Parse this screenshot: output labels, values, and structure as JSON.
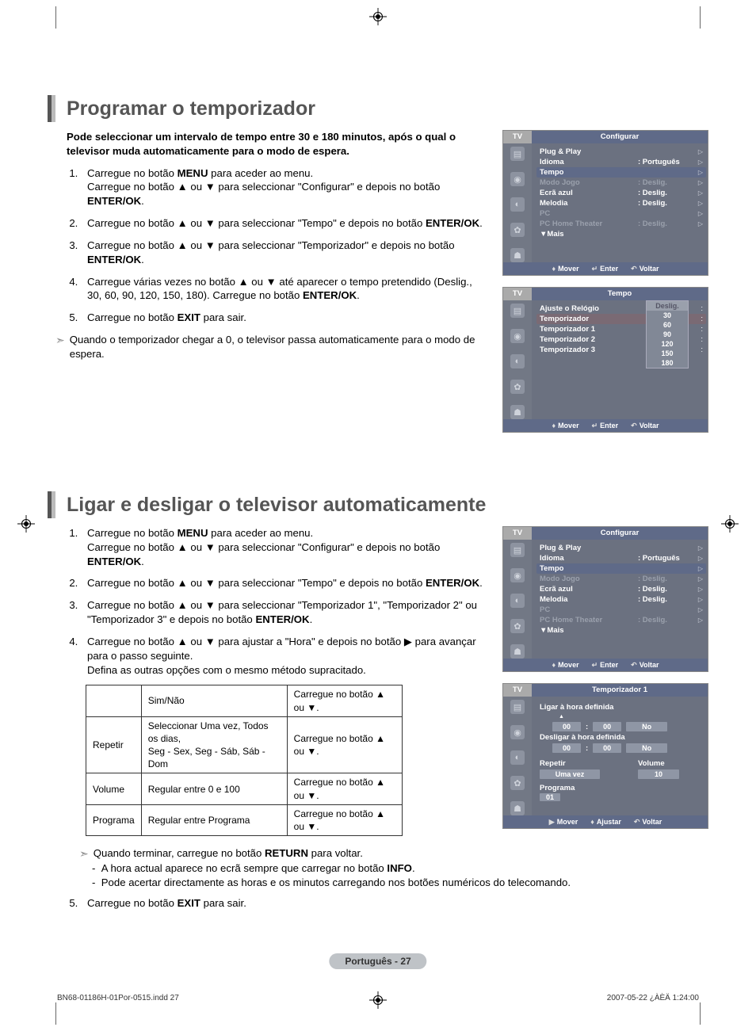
{
  "section1": {
    "title": "Programar o temporizador",
    "intro": "Pode seleccionar um intervalo de tempo entre 30 e 180 minutos, após o qual o televisor muda automaticamente para o modo de espera.",
    "steps": {
      "s1a": "Carregue no botão ",
      "s1b": " para aceder ao menu.",
      "s1c": "Carregue no botão ▲ ou ▼ para seleccionar \"Configurar\" e depois no botão ",
      "s1d": ".",
      "s2a": "Carregue no botão ▲ ou ▼ para seleccionar \"Tempo\" e depois no botão ",
      "s2b": ".",
      "s3a": "Carregue no botão ▲ ou ▼ para seleccionar \"Temporizador\" e depois no botão ",
      "s3b": ".",
      "s4a": "Carregue várias vezes no botão ▲ ou ▼ até aparecer o tempo pretendido (Deslig., 30, 60, 90, 120, 150, 180). Carregue no botão ",
      "s4b": ".",
      "s5a": "Carregue no botão ",
      "s5b": " para sair.",
      "note": "Quando o temporizador chegar a 0, o televisor passa automaticamente para o modo de espera."
    },
    "labels": {
      "menu": "MENU",
      "enterok": "ENTER/OK",
      "exit": "EXIT"
    }
  },
  "section2": {
    "title": "Ligar e desligar o televisor automaticamente",
    "steps": {
      "s1a": "Carregue no botão ",
      "s1b": " para aceder ao menu.",
      "s1c": "Carregue no botão ▲ ou ▼ para seleccionar \"Configurar\" e depois no botão ",
      "s1d": ".",
      "s2a": "Carregue no botão ▲ ou ▼ para seleccionar \"Tempo\" e depois no botão ",
      "s2b": ".",
      "s3a": "Carregue no botão ▲ ou ▼ para seleccionar \"Temporizador 1\", \"Temporizador 2\" ou \"Temporizador 3\" e depois no botão ",
      "s3b": ".",
      "s4a": "Carregue no botão ▲ ou ▼ para ajustar a \"Hora\" e depois no botão ▶ para avançar para o passo seguinte.",
      "s4b": "Defina as outras opções com o mesmo método supracitado.",
      "s5a": "Carregue no botão ",
      "s5b": " para sair."
    },
    "labels": {
      "menu": "MENU",
      "enterok": "ENTER/OK",
      "exit": "EXIT",
      "return": "RETURN",
      "info": "INFO"
    },
    "table": {
      "r1c1": "",
      "r1c2": "Sim/Não",
      "r1c3": "Carregue no botão ▲ ou ▼.",
      "r2c1": "Repetir",
      "r2c2": "Seleccionar Uma vez, Todos os dias,\nSeg - Sex, Seg - Sáb, Sáb - Dom",
      "r2c3": "Carregue no botão ▲ ou ▼.",
      "r3c1": "Volume",
      "r3c2": "Regular entre 0 e 100",
      "r3c3": "Carregue no botão ▲ ou ▼.",
      "r4c1": "Programa",
      "r4c2": "Regular entre Programa",
      "r4c3": "Carregue no botão ▲ ou ▼."
    },
    "after": {
      "note1a": "Quando terminar, carregue no botão ",
      "note1b": " para voltar.",
      "dash1a": "A hora actual aparece no ecrã sempre que carregar no botão ",
      "dash1b": ".",
      "dash2": "Pode acertar directamente as horas e os minutos carregando nos botões numéricos do telecomando."
    }
  },
  "osd_configurar": {
    "tv": "TV",
    "title": "Configurar",
    "rows": {
      "plug": "Plug & Play",
      "idioma": "Idioma",
      "idioma_val": ": Português",
      "tempo": "Tempo",
      "modojogo": "Modo Jogo",
      "modojogo_val": ": Deslig.",
      "ecra": "Ecrã azul",
      "ecra_val": ": Deslig.",
      "melodia": "Melodia",
      "melodia_val": ": Deslig.",
      "pc": "PC",
      "pcht": "PC Home Theater",
      "pcht_val": ": Deslig.",
      "mais": "▼Mais"
    },
    "footer": {
      "mover": "Mover",
      "enter": "Enter",
      "voltar": "Voltar"
    }
  },
  "osd_tempo": {
    "tv": "TV",
    "title": "Tempo",
    "rows": {
      "relogio": "Ajuste o Relógio",
      "relogio_c": ":",
      "temporizador": "Temporizador",
      "temporizador_c": ":",
      "t1": "Temporizador 1",
      "t1c": ":",
      "t2": "Temporizador 2",
      "t2c": ":",
      "t3": "Temporizador 3",
      "t3c": ":"
    },
    "dropdown": [
      "Deslig.",
      "30",
      "60",
      "90",
      "120",
      "150",
      "180"
    ],
    "footer": {
      "mover": "Mover",
      "enter": "Enter",
      "voltar": "Voltar"
    }
  },
  "osd_configurar2": {
    "tv": "TV",
    "title": "Configurar",
    "footer": {
      "mover": "Mover",
      "enter": "Enter",
      "voltar": "Voltar"
    }
  },
  "osd_timer1": {
    "tv": "TV",
    "title": "Temporizador 1",
    "ligar_label": "Ligar à hora definida",
    "desligar_label": "Desligar à hora definida",
    "h": "00",
    "m": "00",
    "no": "No",
    "repetir": "Repetir",
    "repetir_val": "Uma vez",
    "volume": "Volume",
    "volume_val": "10",
    "programa": "Programa",
    "programa_val": "01",
    "footer": {
      "mover": "Mover",
      "ajustar": "Ajustar",
      "voltar": "Voltar"
    }
  },
  "page_number": "Português - 27",
  "footer_left": "BN68-01186H-01Por-0515.indd   27",
  "footer_right": "2007-05-22   ¿ÀÈÄ 1:24:00"
}
